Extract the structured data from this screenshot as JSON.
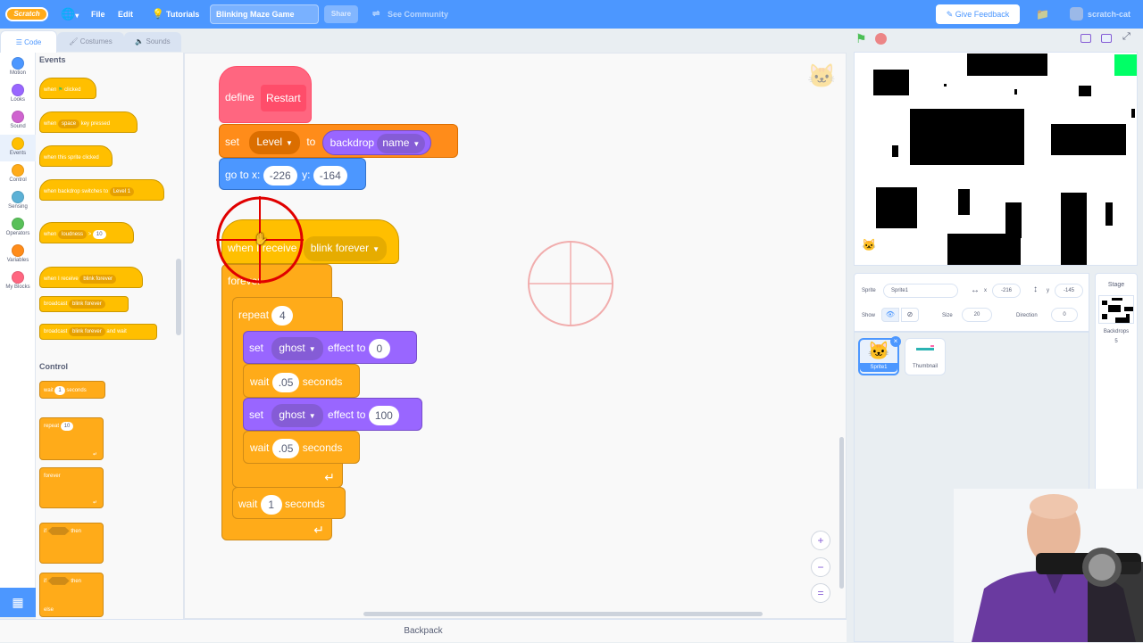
{
  "menu": {
    "logo_text": "Scratch",
    "file": "File",
    "edit": "Edit",
    "tutorials": "Tutorials",
    "project_title": "Blinking Maze Game",
    "share": "Share",
    "see_community": "See Community",
    "give_feedback": "Give Feedback",
    "username": "scratch-cat"
  },
  "tabs": {
    "code": "Code",
    "costumes": "Costumes",
    "sounds": "Sounds"
  },
  "categories": [
    {
      "label": "Motion",
      "color": "#4c97ff"
    },
    {
      "label": "Looks",
      "color": "#9966ff"
    },
    {
      "label": "Sound",
      "color": "#cf63cf"
    },
    {
      "label": "Events",
      "color": "#ffbf00"
    },
    {
      "label": "Control",
      "color": "#ffab19"
    },
    {
      "label": "Sensing",
      "color": "#5cb1d6"
    },
    {
      "label": "Operators",
      "color": "#59c059"
    },
    {
      "label": "Variables",
      "color": "#ff8c1a"
    },
    {
      "label": "My Blocks",
      "color": "#ff6680"
    }
  ],
  "palette": {
    "events_header": "Events",
    "control_header": "Control",
    "when_flag_1": "when",
    "when_flag_2": "clicked",
    "when_key_1": "when",
    "when_key_dd": "space",
    "when_key_2": "key pressed",
    "when_sprite_clicked": "when this sprite clicked",
    "when_backdrop_1": "when backdrop switches to",
    "when_backdrop_dd": "Level 1",
    "when_loud_1": "when",
    "when_loud_dd": "loudness",
    "when_loud_op": ">",
    "when_loud_val": "10",
    "when_receive_1": "when I receive",
    "when_receive_dd": "blink forever",
    "broadcast_1": "broadcast",
    "broadcast_dd": "blink forever",
    "broadcast_wait_1": "broadcast",
    "broadcast_wait_dd": "blink forever",
    "broadcast_wait_2": "and wait",
    "wait_1": "wait",
    "wait_val": "1",
    "wait_2": "seconds",
    "repeat_1": "repeat",
    "repeat_val": "10",
    "forever": "forever",
    "if_1": "if",
    "if_then": "then",
    "ifelse_1": "if",
    "ifelse_then": "then",
    "ifelse_else": "else"
  },
  "script1": {
    "define": "define",
    "define_name": "Restart",
    "set": "set",
    "set_var": "Level",
    "to": "to",
    "backdrop": "backdrop",
    "backdrop_dd": "name",
    "goto": "go to x:",
    "goto_x": "-226",
    "goto_y_label": "y:",
    "goto_y": "-164"
  },
  "script2": {
    "when_receive": "when I receive",
    "when_receive_dd": "blink forever",
    "forever": "forever",
    "repeat": "repeat",
    "repeat_val": "4",
    "set1": "set",
    "set1_dd": "ghost",
    "set1_effect": "effect to",
    "set1_val": "0",
    "wait1": "wait",
    "wait1_val": ".05",
    "wait1_sec": "seconds",
    "set2": "set",
    "set2_dd": "ghost",
    "set2_effect": "effect to",
    "set2_val": "100",
    "wait2": "wait",
    "wait2_val": ".05",
    "wait2_sec": "seconds",
    "wait3": "wait",
    "wait3_val": "1",
    "wait3_sec": "seconds"
  },
  "backpack": "Backpack",
  "sprite_info": {
    "sprite_label": "Sprite",
    "sprite_name": "Sprite1",
    "x_label": "x",
    "x_val": "-216",
    "y_label": "y",
    "y_val": "-145",
    "show_label": "Show",
    "size_label": "Size",
    "size_val": "20",
    "direction_label": "Direction",
    "direction_val": "0"
  },
  "sprites": [
    {
      "name": "Sprite1"
    },
    {
      "name": "Thumbnail"
    }
  ],
  "stage_panel": {
    "title": "Stage",
    "backdrops_label": "Backdrops",
    "backdrops_count": "5"
  },
  "zoom": {
    "in": "+",
    "out": "−",
    "reset": "="
  }
}
